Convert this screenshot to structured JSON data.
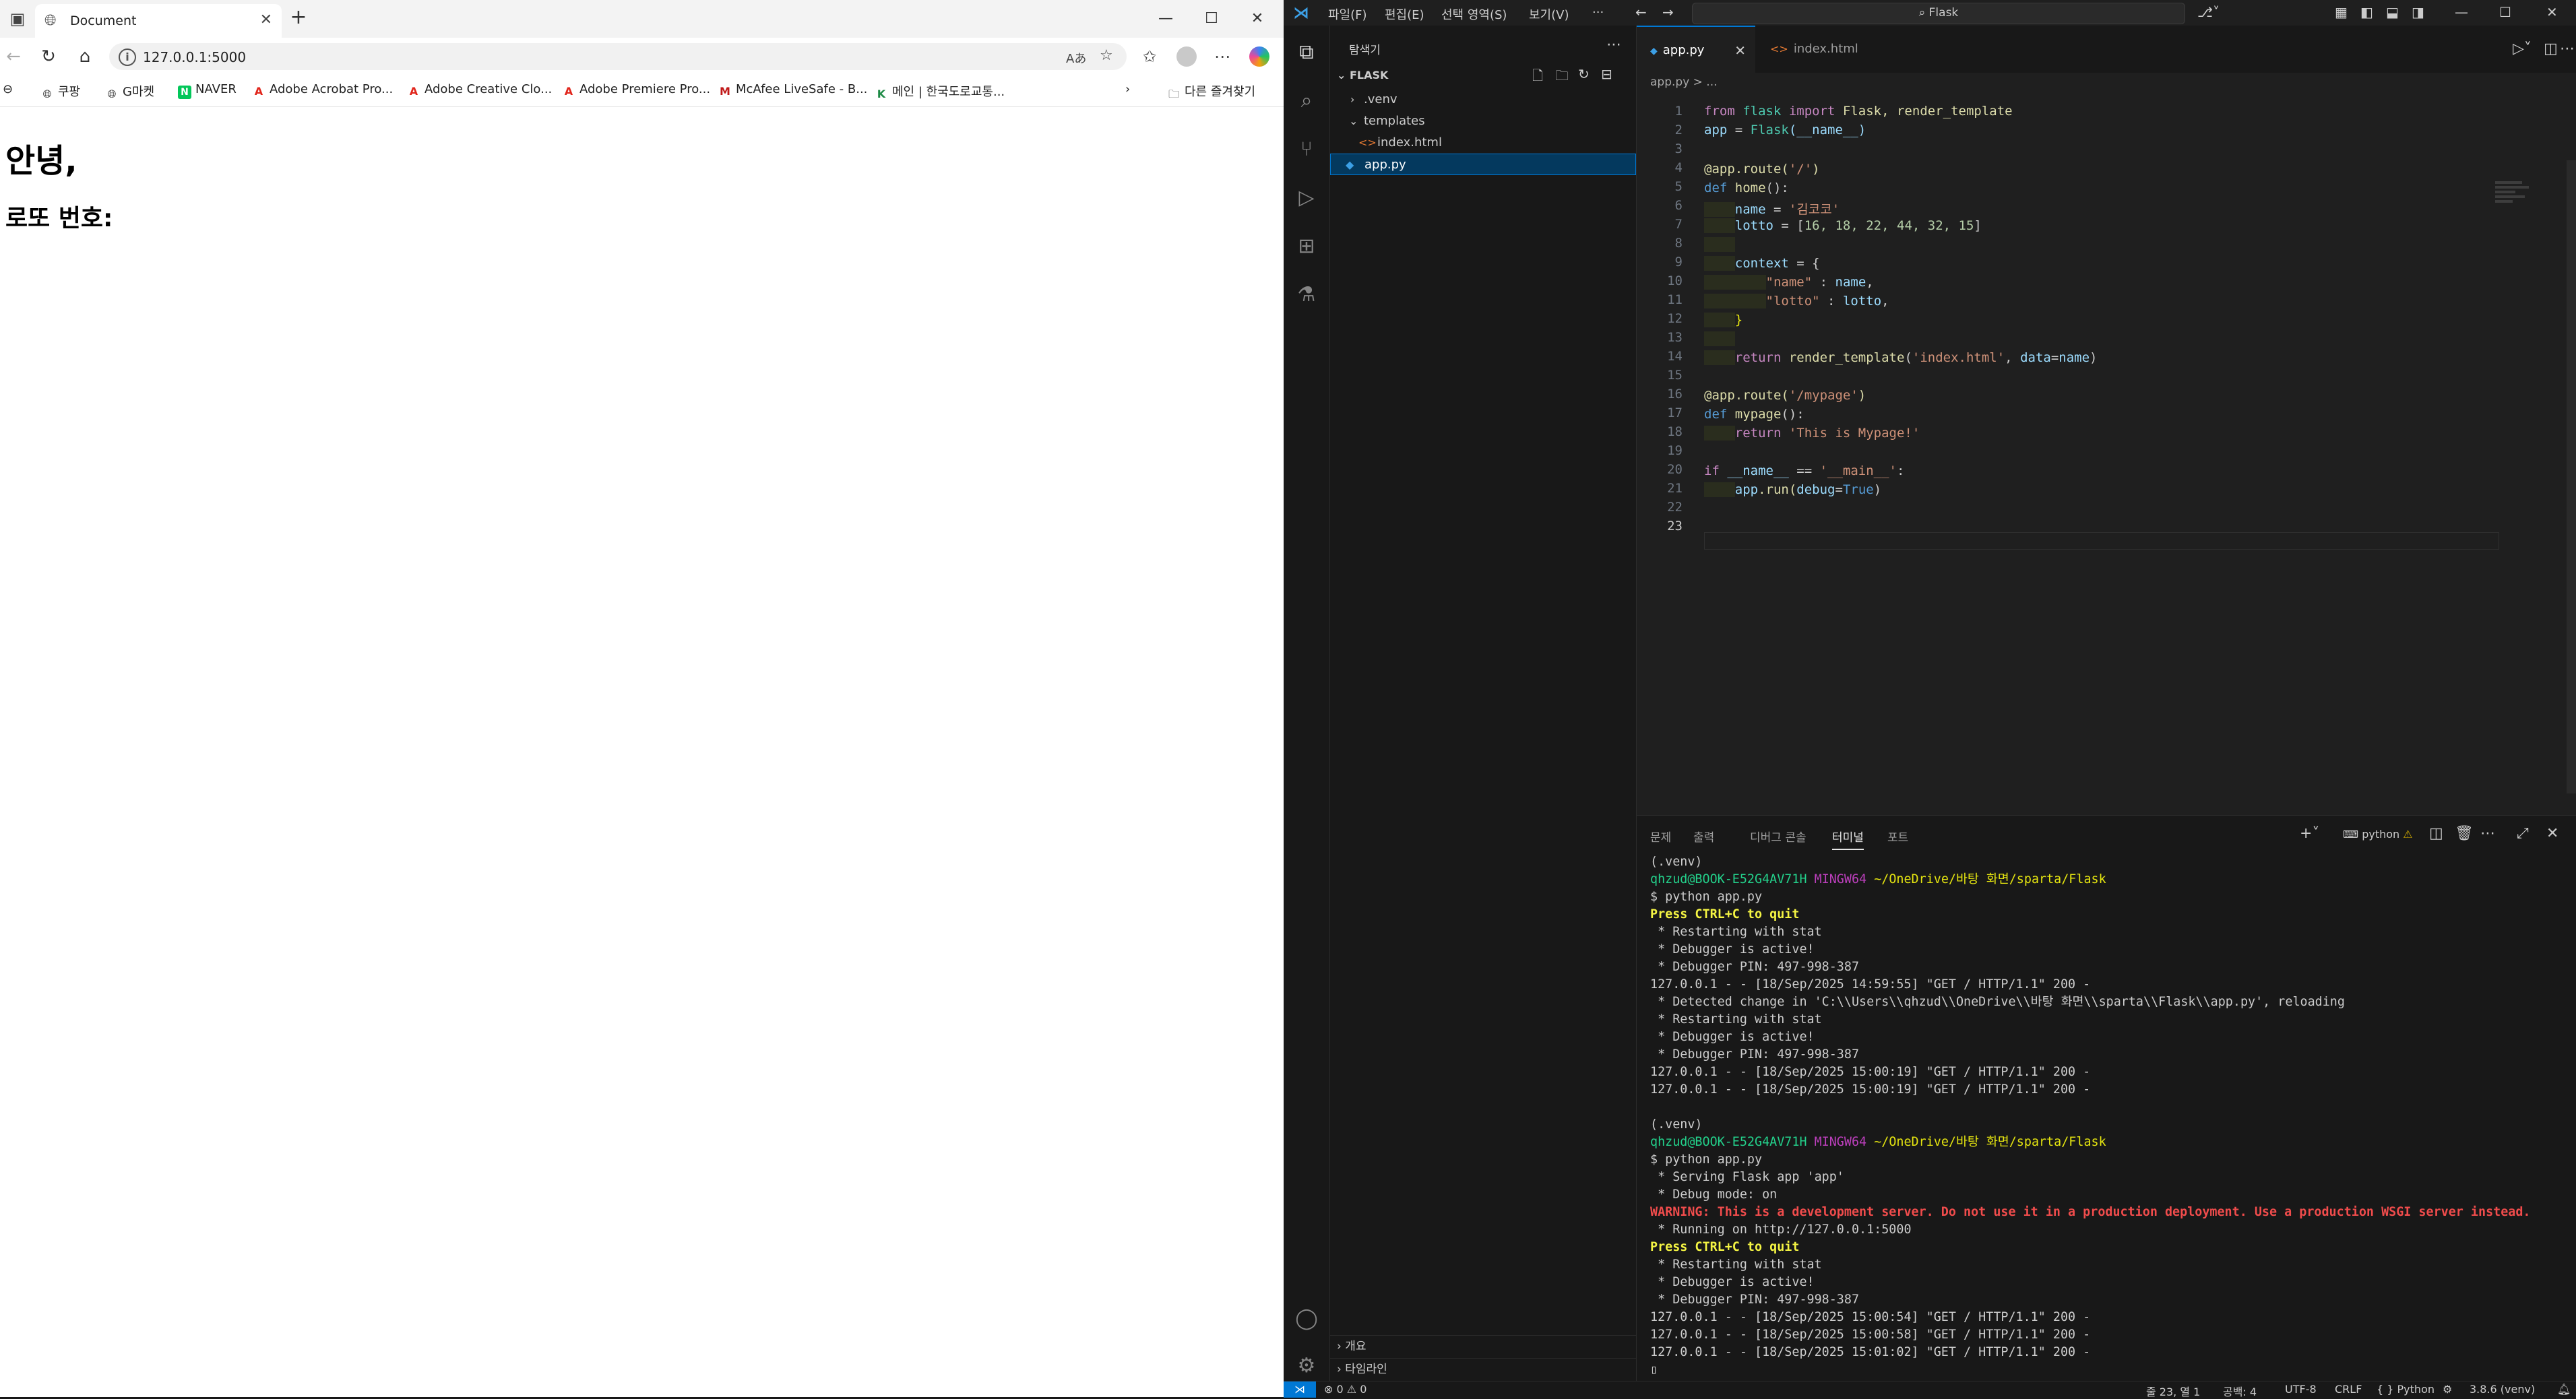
{
  "browser": {
    "tab_title": "Document",
    "url": "127.0.0.1:5000",
    "bookmarks": [
      {
        "label": "쿠팡"
      },
      {
        "label": "G마켓"
      },
      {
        "label": "NAVER"
      },
      {
        "label": "Adobe Acrobat Pro..."
      },
      {
        "label": "Adobe Creative Clo..."
      },
      {
        "label": "Adobe Premiere Pro..."
      },
      {
        "label": "McAfee LiveSafe - B..."
      },
      {
        "label": "메인 | 한국도로교통..."
      }
    ],
    "other_favorites": "다른 즐겨찾기",
    "page": {
      "heading": "안녕,",
      "subheading": "로또 번호:"
    }
  },
  "vscode": {
    "menu": [
      "파일(F)",
      "편집(E)",
      "선택 영역(S)",
      "보기(V)",
      "···"
    ],
    "search_label": "Flask",
    "explorer": {
      "title": "탐색기",
      "folder": "FLASK",
      "items": [
        ".venv",
        "templates",
        "index.html",
        "app.py"
      ],
      "outline": "개요",
      "timeline": "타임라인"
    },
    "tabs": [
      "app.py",
      "index.html"
    ],
    "breadcrumb": "app.py > ...",
    "line_numbers": [
      "1",
      "2",
      "3",
      "4",
      "5",
      "6",
      "7",
      "8",
      "9",
      "10",
      "11",
      "12",
      "13",
      "14",
      "15",
      "16",
      "17",
      "18",
      "19",
      "20",
      "21",
      "22",
      "23"
    ],
    "code": {
      "l1": {
        "a": "from",
        "b": " flask ",
        "c": "import",
        "d": " Flask, render_template"
      },
      "l2": {
        "a": "app",
        "b": " = ",
        "c": "Flask",
        "d": "(__name__)"
      },
      "l4": {
        "a": "@app.route(",
        "b": "'/'",
        "c": ")"
      },
      "l5": {
        "a": "def",
        "b": " home",
        "c": "():"
      },
      "l6": {
        "a": "name",
        "b": " = ",
        "c": "'김코코'"
      },
      "l7": {
        "a": "lotto",
        "b": " = [",
        "c": "16, 18, 22, 44, 32, 15",
        "d": "]"
      },
      "l9": {
        "a": "context",
        "b": " = {"
      },
      "l10": {
        "a": "\"name\"",
        "b": " : ",
        "c": "name",
        "d": ","
      },
      "l11": {
        "a": "\"lotto\"",
        "b": " : ",
        "c": "lotto",
        "d": ","
      },
      "l12": {
        "a": "}"
      },
      "l14": {
        "a": "return",
        "b": " render_template",
        "c": "(",
        "d": "'index.html'",
        "e": ", ",
        "f": "data",
        "g": "=",
        "h": "name",
        "i": ")"
      },
      "l16": {
        "a": "@app.route(",
        "b": "'/mypage'",
        "c": ")"
      },
      "l17": {
        "a": "def",
        "b": " mypage",
        "c": "():"
      },
      "l18": {
        "a": "return",
        "b": " 'This is Mypage!'"
      },
      "l20": {
        "a": "if",
        "b": " __name__ ",
        "c": "==",
        "d": " '__main__'",
        "e": ":"
      },
      "l21": {
        "a": "app",
        "b": ".run(",
        "c": "debug",
        "d": "=",
        "e": "True",
        "f": ")"
      }
    },
    "panel": {
      "tabs": [
        "문제",
        "출력",
        "디버그 콘솔",
        "터미널",
        "포트"
      ],
      "active_tab": "터미널",
      "shell_label": "python"
    },
    "terminal": {
      "venv": "(.venv)",
      "user": "qhzud@BOOK-E52G4AV71H",
      "mingw": "MINGW64",
      "path": "~/OneDrive/바탕 화면/sparta/Flask",
      "cmd": "$ python app.py",
      "quit": "Press CTRL+C to quit",
      "restart": " * Restarting with stat",
      "debugger_active": " * Debugger is active!",
      "pin": " * Debugger PIN: 497-998-387",
      "req1": "127.0.0.1 - - [18/Sep/2025 14:59:55] \"GET / HTTP/1.1\" 200 -",
      "detected": " * Detected change in 'C:\\\\Users\\\\qhzud\\\\OneDrive\\\\바탕 화면\\\\sparta\\\\Flask\\\\app.py', reloading",
      "req2": "127.0.0.1 - - [18/Sep/2025 15:00:19] \"GET / HTTP/1.1\" 200 -",
      "req3": "127.0.0.1 - - [18/Sep/2025 15:00:19] \"GET / HTTP/1.1\" 200 -",
      "serving": " * Serving Flask app 'app'",
      "debugmode": " * Debug mode: on",
      "warning": "WARNING: This is a development server. Do not use it in a production deployment. Use a production WSGI server instead.",
      "running": " * Running on http://127.0.0.1:5000",
      "req4": "127.0.0.1 - - [18/Sep/2025 15:00:54] \"GET / HTTP/1.1\" 200 -",
      "req5": "127.0.0.1 - - [18/Sep/2025 15:00:58] \"GET / HTTP/1.1\" 200 -",
      "req6": "127.0.0.1 - - [18/Sep/2025 15:01:02] \"GET / HTTP/1.1\" 200 -"
    },
    "status": {
      "problems": "⊗ 0 ⚠ 0",
      "position": "줄 23, 열 1",
      "spaces": "공백: 4",
      "encoding": "UTF-8",
      "eol": "CRLF",
      "language": "{ } Python",
      "interpreter": "3.8.6 (venv)"
    }
  }
}
